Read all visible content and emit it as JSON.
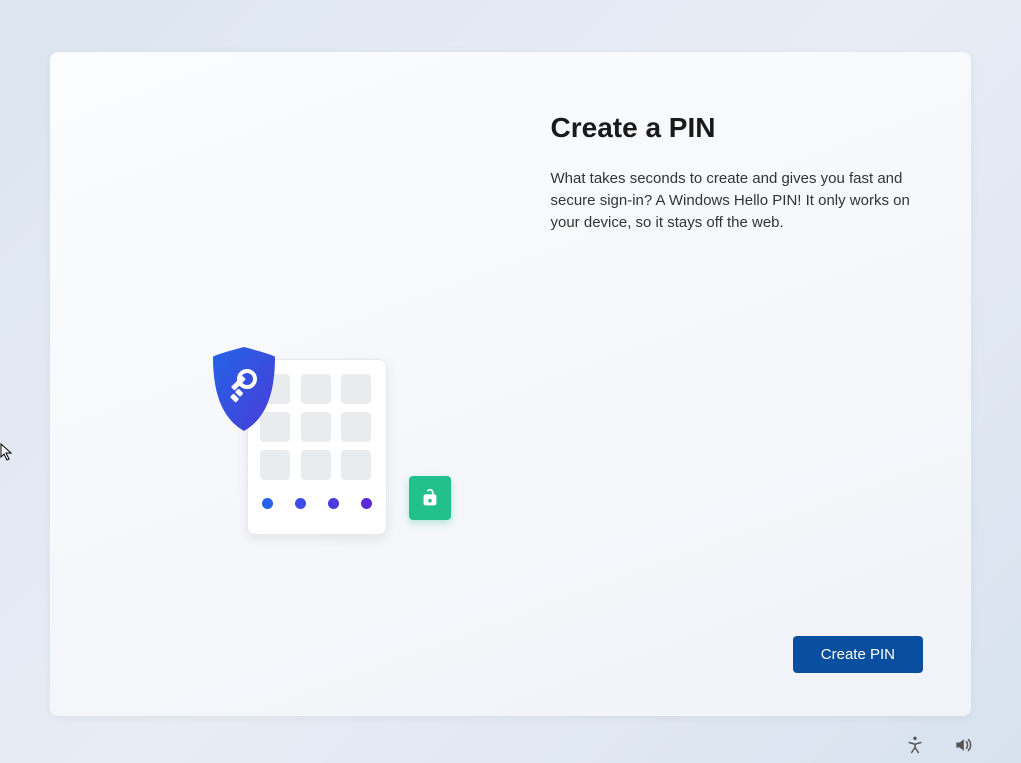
{
  "screen": {
    "title": "Create a PIN",
    "description": "What takes seconds to create and gives you fast and secure sign-in? A Windows Hello PIN! It only works on your device, so it stays off the web.",
    "primary_button_label": "Create PIN"
  },
  "icons": {
    "shield": "shield-key-icon",
    "lock": "unlock-icon",
    "accessibility": "accessibility-icon",
    "volume": "volume-icon"
  },
  "colors": {
    "primary_button_bg": "#0a4ea0",
    "accent_green": "#22c08a",
    "shield_gradient_start": "#2463e6",
    "shield_gradient_end": "#4a3dd8"
  }
}
